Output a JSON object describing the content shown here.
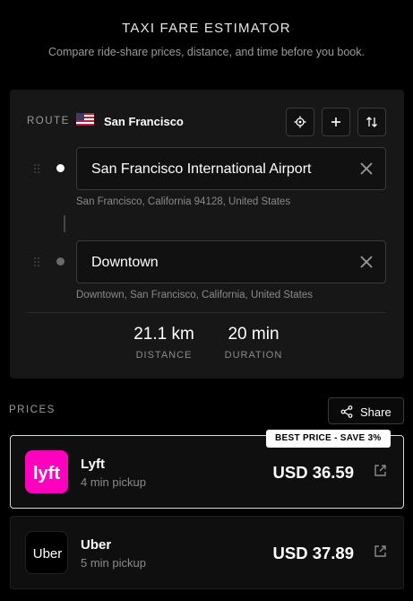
{
  "header": {
    "title": "TAXI FARE ESTIMATOR",
    "subtitle": "Compare ride-share prices, distance, and time before you book."
  },
  "route": {
    "label": "ROUTE",
    "flag_icon": "us-flag-icon",
    "city": "San Francisco",
    "actions": [
      "locate-icon",
      "plus-icon",
      "swap-icon"
    ],
    "origin": {
      "value": "San Francisco International Airport",
      "subtext": "San Francisco, California 94128, United States"
    },
    "destination": {
      "value": "Downtown",
      "subtext": "Downtown, San Francisco, California, United States"
    },
    "stats": {
      "distance_value": "21.1 km",
      "distance_label": "DISTANCE",
      "duration_value": "20 min",
      "duration_label": "DURATION"
    }
  },
  "prices": {
    "label": "PRICES",
    "share_label": "Share",
    "items": [
      {
        "name": "Lyft",
        "pickup": "4 min pickup",
        "price": "USD 36.59",
        "badge": "BEST PRICE - SAVE 3%",
        "logo_text": "lyft",
        "logo_color": "#FF00BF"
      },
      {
        "name": "Uber",
        "pickup": "5 min pickup",
        "price": "USD 37.89",
        "logo_text": "Uber",
        "logo_color": "#000000"
      }
    ]
  },
  "colors": {
    "background": "#000000",
    "card": "#171717",
    "lyft_pink": "#FF00BF",
    "muted_text": "#8A8A8A"
  }
}
